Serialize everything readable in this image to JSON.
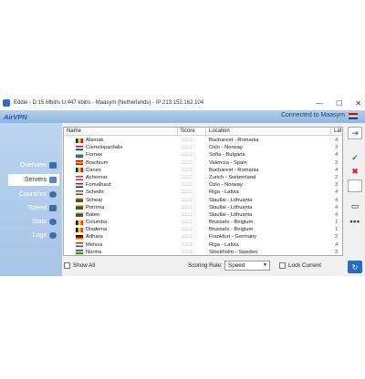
{
  "window": {
    "title": "Eddie - D:15 Mbit/s U:447 kbit/s - Maasym (Netherlands) - IP:213.152.162.104",
    "controls": {
      "minimize": "—",
      "maximize": "☐",
      "close": "✕"
    }
  },
  "header": {
    "logo": "AirVPN",
    "status": "Connected to Maasym",
    "status_flag": "netherlands-flag"
  },
  "sidebar": {
    "items": [
      {
        "label": "Overview",
        "icon": "monitor-icon"
      },
      {
        "label": "Servers",
        "icon": "server-list-icon"
      },
      {
        "label": "Countries",
        "icon": "globe-icon"
      },
      {
        "label": "Speed",
        "icon": "chart-icon"
      },
      {
        "label": "Stats",
        "icon": "info-icon"
      },
      {
        "label": "Logs",
        "icon": "gears-icon"
      }
    ],
    "active": "Servers"
  },
  "table": {
    "columns": [
      "Name",
      "Score",
      "Location",
      "Lat"
    ],
    "rows": [
      {
        "name": "Alamak",
        "location": "Bucharest - Romania",
        "lat": "4",
        "flag": "ro"
      },
      {
        "name": "Camelopardalis",
        "location": "Oslo - Norway",
        "lat": "3",
        "flag": "no"
      },
      {
        "name": "Fornax",
        "location": "Sofia - Bulgaria",
        "lat": "4",
        "flag": "bg"
      },
      {
        "name": "Brachium",
        "location": "Valencia - Spain",
        "lat": "3",
        "flag": "es"
      },
      {
        "name": "Canes",
        "location": "Bucharest - Romania",
        "lat": "4",
        "flag": "ro"
      },
      {
        "name": "Achernar",
        "location": "Zurich - Switzerland",
        "lat": "2",
        "flag": "ch"
      },
      {
        "name": "Fomalhaut",
        "location": "Oslo - Norway",
        "lat": "3",
        "flag": "no"
      },
      {
        "name": "Schedir",
        "location": "Riga - Latvia",
        "lat": "4",
        "flag": "lv"
      },
      {
        "name": "Scheat",
        "location": "Siauliai - Lithuania",
        "lat": "4",
        "flag": "lt"
      },
      {
        "name": "Porrima",
        "location": "Siauliai - Lithuania",
        "lat": "4",
        "flag": "lt"
      },
      {
        "name": "Baten",
        "location": "Siauliai - Lithuania",
        "lat": "4",
        "flag": "lt"
      },
      {
        "name": "Columba",
        "location": "Brussels - Belgium",
        "lat": "1",
        "flag": "be"
      },
      {
        "name": "Diadema",
        "location": "Brussels - Belgium",
        "lat": "1",
        "flag": "be"
      },
      {
        "name": "Adhara",
        "location": "Frankfurt - Germany",
        "lat": "2",
        "flag": "de"
      },
      {
        "name": "Meissa",
        "location": "Riga - Latvia",
        "lat": "4",
        "flag": "lv"
      },
      {
        "name": "Norma",
        "location": "Stockholm - Sweden",
        "lat": "3",
        "flag": "se"
      }
    ],
    "score_placeholder": "□□□□□"
  },
  "bottom": {
    "show_all_label": "Show All",
    "scoring_rule_label": "Scoring Rule:",
    "scoring_rule_value": "Speed",
    "scoring_rule_arrow": "▼",
    "lock_current_label": "Lock Current"
  },
  "rightbar": {
    "buttons": [
      {
        "name": "connect-arrow-icon",
        "glyph": "⇥"
      },
      {
        "name": "checkmark-icon",
        "glyph": "✔"
      },
      {
        "name": "x-mark-icon",
        "glyph": "✖"
      },
      {
        "name": "empty-button",
        "glyph": ""
      },
      {
        "name": "server-settings-icon",
        "glyph": "▭"
      },
      {
        "name": "more-icon",
        "glyph": "•••"
      },
      {
        "name": "refresh-icon",
        "glyph": "↻"
      }
    ]
  },
  "flag_colors": {
    "ro": [
      "#002b7f",
      "#fcd116",
      "#ce1126"
    ],
    "no": [
      "#ba0c2f",
      "#ffffff",
      "#00205b"
    ],
    "bg": [
      "#ffffff",
      "#00966e",
      "#d62612"
    ],
    "es": [
      "#aa151b",
      "#f1bf00",
      "#aa151b"
    ],
    "ch": [
      "#d52b1e",
      "#ffffff",
      "#d52b1e"
    ],
    "lv": [
      "#9e3039",
      "#ffffff",
      "#9e3039"
    ],
    "lt": [
      "#fdb913",
      "#006a44",
      "#c1272d"
    ],
    "be": [
      "#000000",
      "#fdda24",
      "#ef3340"
    ],
    "de": [
      "#000000",
      "#dd0000",
      "#ffce00"
    ],
    "se": [
      "#006aa7",
      "#fecc00",
      "#006aa7"
    ]
  }
}
